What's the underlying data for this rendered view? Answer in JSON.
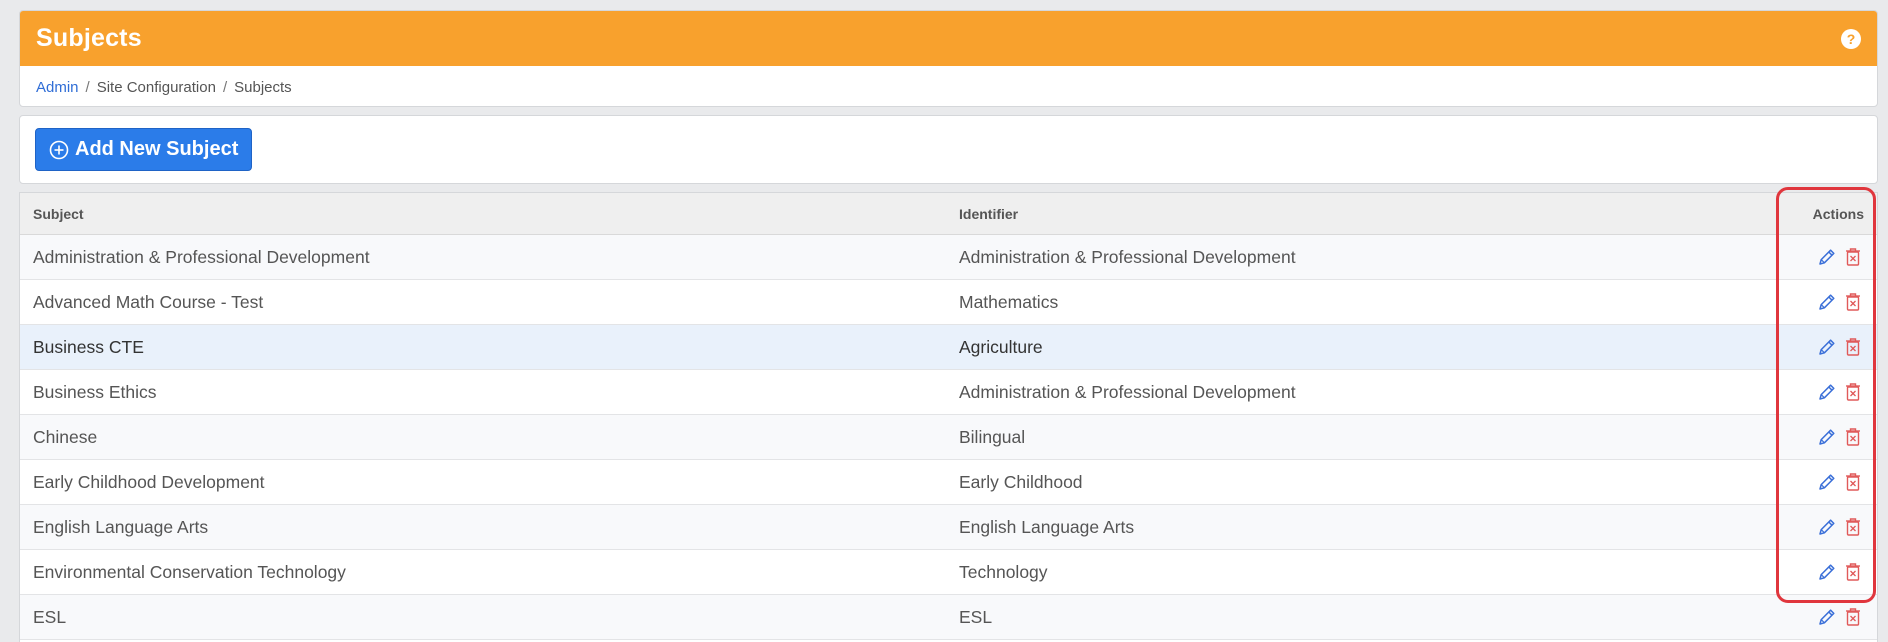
{
  "header": {
    "title": "Subjects",
    "help_label": "?"
  },
  "breadcrumb": {
    "admin": "Admin",
    "site_configuration": "Site Configuration",
    "subjects": "Subjects",
    "separator": "/"
  },
  "toolbar": {
    "add_label": "Add New Subject"
  },
  "table": {
    "headers": {
      "subject": "Subject",
      "identifier": "Identifier",
      "actions": "Actions"
    },
    "rows": [
      {
        "subject": "Administration & Professional Development",
        "identifier": "Administration & Professional Development"
      },
      {
        "subject": "Advanced Math Course - Test",
        "identifier": "Mathematics"
      },
      {
        "subject": "Business CTE",
        "identifier": "Agriculture"
      },
      {
        "subject": "Business Ethics",
        "identifier": "Administration & Professional Development"
      },
      {
        "subject": "Chinese",
        "identifier": "Bilingual"
      },
      {
        "subject": "Early Childhood Development",
        "identifier": "Early Childhood"
      },
      {
        "subject": "English Language Arts",
        "identifier": "English Language Arts"
      },
      {
        "subject": "Environmental Conservation Technology",
        "identifier": "Technology"
      },
      {
        "subject": "ESL",
        "identifier": "ESL"
      }
    ]
  },
  "icons": {
    "edit": "pencil-icon",
    "delete": "trash-icon",
    "add": "plus-circle-icon",
    "help": "question-icon"
  },
  "colors": {
    "header_bg": "#f8a12d",
    "primary_button": "#2b7ce9",
    "link": "#2f6dd6",
    "edit_icon": "#3a6fd8",
    "delete_icon": "#e05a5a",
    "highlight_outline": "#e0363d"
  }
}
